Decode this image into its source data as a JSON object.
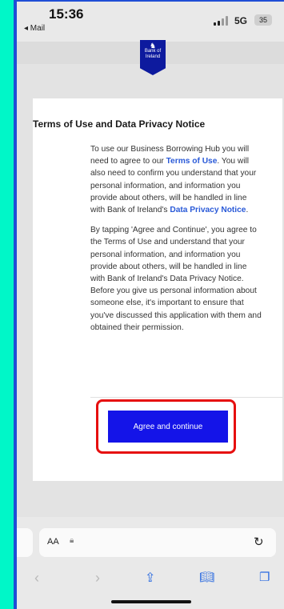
{
  "status_bar": {
    "time": "15:36",
    "back_app": "◂ Mail",
    "network": "5G",
    "battery": "35"
  },
  "brand": {
    "logo_text": "Bank of Ireland",
    "logo_color": "#0d1a9e"
  },
  "notice": {
    "title": "Terms of Use and Data Privacy Notice",
    "para1_part1": "To use our Business Borrowing Hub you will need to agree to our ",
    "terms_link": "Terms of Use",
    "para1_part2": ". You will also need to confirm you understand that your personal information, and information you provide about others, will be handled in line with Bank of Ireland's ",
    "privacy_link": "Data Privacy Notice",
    "para1_part3": ".",
    "para2": "By tapping 'Agree and Continue', you agree to the Terms of Use and understand that your personal information, and information you provide about others, will be handled in line with Bank of Ireland's Data Privacy Notice. Before you give us personal information about someone else, it's important to ensure that you've discussed this application with them and obtained their permission.",
    "agree_button": "Agree and continue",
    "link_color": "#2a5ad8",
    "button_color": "#1414e8",
    "highlight_color": "#e60f0f"
  },
  "browser": {
    "text_size_label": "AA",
    "lock_icon": "lock-icon",
    "reload_icon": "reload-icon",
    "nav": {
      "back_icon": "chevron-left-icon",
      "forward_icon": "chevron-right-icon",
      "share_icon": "share-icon",
      "bookmarks_icon": "book-icon",
      "tabs_icon": "tabs-icon"
    }
  }
}
